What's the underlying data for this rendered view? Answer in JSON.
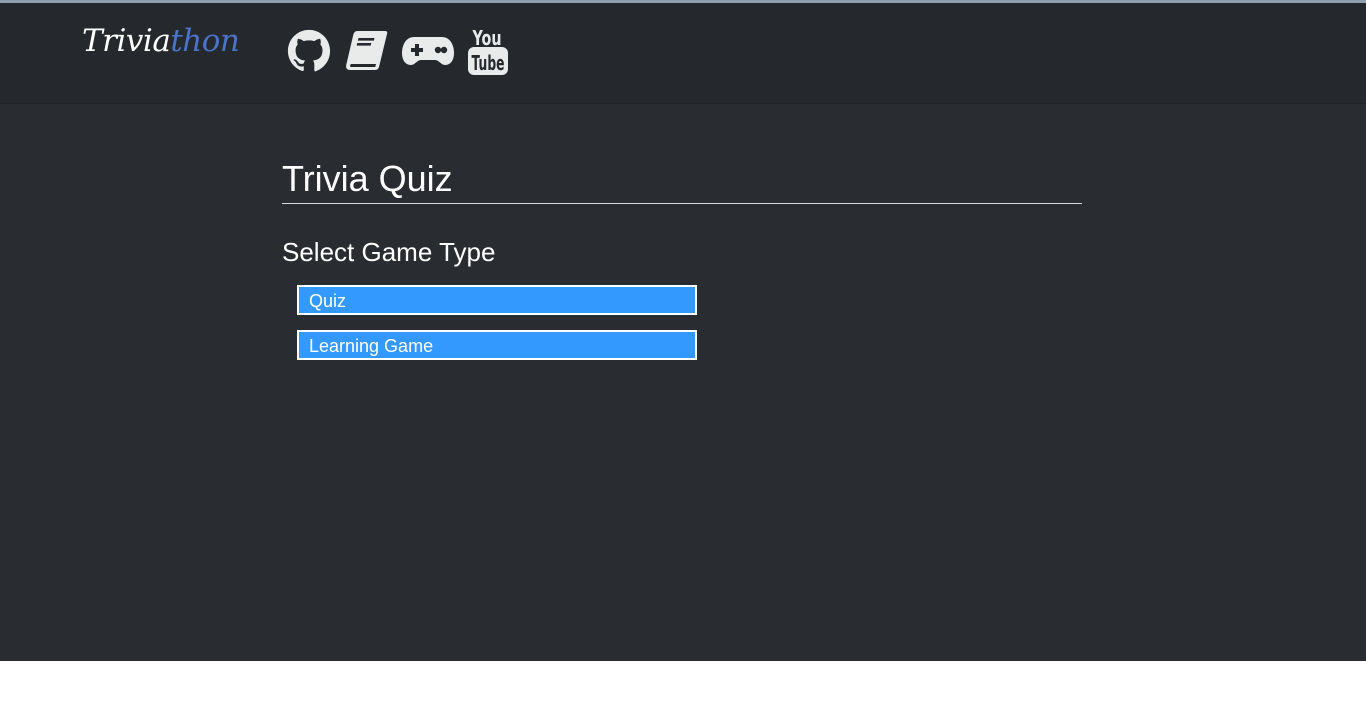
{
  "brand": {
    "part1": "Trivia",
    "part2": "thon"
  },
  "nav": [
    {
      "name": "github-icon"
    },
    {
      "name": "book-icon"
    },
    {
      "name": "gamepad-icon"
    },
    {
      "name": "youtube-icon",
      "text_top": "You",
      "text_bottom": "Tube"
    }
  ],
  "main": {
    "title": "Trivia Quiz",
    "subtitle": "Select Game Type",
    "options": [
      "Quiz",
      "Learning Game"
    ]
  },
  "colors": {
    "header": "#25282c",
    "panel": "#292c30",
    "accent": "#3399ff",
    "brand_accent": "#4a74c9"
  }
}
